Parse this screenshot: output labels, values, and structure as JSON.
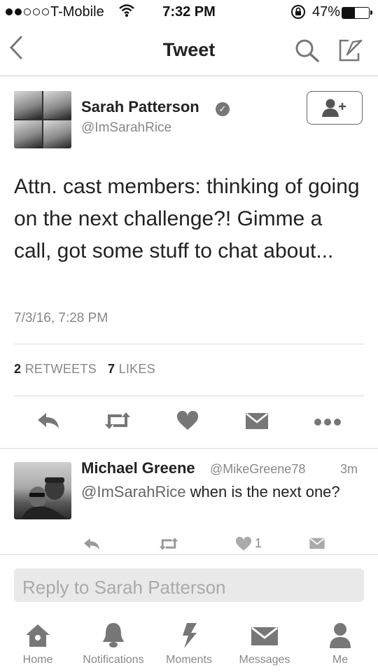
{
  "status_bar": {
    "carrier": "T-Mobile",
    "time": "7:32 PM",
    "battery": "47%",
    "battery_level": 0.47,
    "signal_dots_filled": 2,
    "signal_dots_total": 5
  },
  "nav": {
    "title": "Tweet",
    "icons": [
      "chevron-left-icon",
      "search-icon",
      "compose-icon"
    ]
  },
  "tweet": {
    "author_name": "Sarah Patterson",
    "author_handle": "@ImSarahRice",
    "verified": true,
    "text": "Attn. cast members: thinking of going on the next challenge?! Gimme a call, got some stuff to chat about...",
    "date": "7/3/16, 7:28 PM",
    "retweets_count": "2",
    "retweets_label": "RETWEETS",
    "likes_count": "7",
    "likes_label": "LIKES",
    "actions": [
      "reply-icon",
      "retweet-icon",
      "heart-icon",
      "message-icon",
      "more-icon"
    ]
  },
  "reply": {
    "author_name": "Michael Greene",
    "author_handle": "@MikeGreene78",
    "time": "3m",
    "mention": "@ImSarahRice",
    "text": " when is the next one?",
    "like_count": "1"
  },
  "composer": {
    "placeholder": "Reply to Sarah Patterson"
  },
  "tabs": [
    {
      "label": "Home",
      "icon": "home-icon"
    },
    {
      "label": "Notifications",
      "icon": "bell-icon"
    },
    {
      "label": "Moments",
      "icon": "lightning-icon"
    },
    {
      "label": "Messages",
      "icon": "envelope-icon"
    },
    {
      "label": "Me",
      "icon": "person-icon"
    }
  ],
  "colors": {
    "text": "#222222",
    "secondary": "#888888",
    "icon": "#777777"
  }
}
